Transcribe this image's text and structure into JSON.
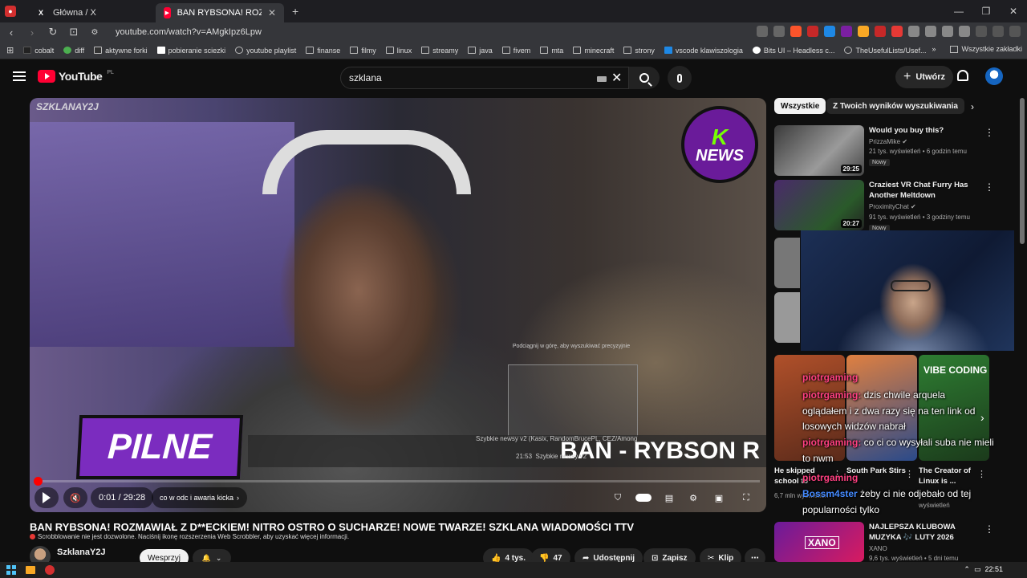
{
  "browser": {
    "tabs": [
      {
        "label": "Główna / X",
        "active": false
      },
      {
        "label": "BAN RYBSONA! ROZMAWIAŁ Z D",
        "active": true
      }
    ],
    "url": "youtube.com/watch?v=AMgkIpz6Lpw",
    "bookmarks": [
      "cobalt",
      "diff",
      "aktywne forki",
      "pobieranie sciezki",
      "youtube playlist",
      "finanse",
      "filmy",
      "linux",
      "streamy",
      "java",
      "fivem",
      "mta",
      "minecraft",
      "strony",
      "vscode klawiszologia",
      "Bits UI – Headless c...",
      "TheUsefulLists/Usef..."
    ],
    "bookmarks_right": "Wszystkie zakładki"
  },
  "youtube": {
    "logo_text": "YouTube",
    "logo_region": "PL",
    "search_value": "szklana",
    "create_label": "Utwórz"
  },
  "player": {
    "watermark": "SZKLANAY2J",
    "news_logo_k": "K",
    "news_logo_text": "NEWS",
    "pilne": "PILNE",
    "ticker": "BAN - RYBSON R",
    "pip_hint": "Podciągnij w górę, aby wyszukiwać precyzyjnie",
    "info_card": "Szybkie newsy v2 (Kasix, RandomBrucePL, CEZ/Among",
    "info_time": "21:53",
    "info_sub": "Szybkie newsy v2",
    "time": "0:01 / 29:28",
    "chapter": "co w odc i awaria kicka",
    "progress": 0.0006
  },
  "video": {
    "title": "BAN RYBSONA! ROZMAWIAŁ Z D**ECKIEM! NITRO OSTRO O SUCHARZE! NOWE TWARZE! SZKLANA WIADOMOŚCI TTV",
    "scrobbler_note": "Scrobblowanie nie jest dozwolone. Naciśnij ikonę rozszerzenia Web Scrobbler, aby uzyskać więcej informacji.",
    "channel": "SzklanaY2J",
    "support_label": "Wesprzyj",
    "likes": "4 tys.",
    "dislikes": "47",
    "share_label": "Udostępnij",
    "save_label": "Zapisz",
    "clip_label": "Klip"
  },
  "chips": [
    "Wszystkie",
    "Z Twoich wyników wyszukiwania"
  ],
  "recommendations": [
    {
      "title": "Would you buy this?",
      "channel": "PrizzaMike",
      "meta": "21 tys. wyświetleń • 6 godzin temu",
      "duration": "29:25",
      "badge": "Nowy",
      "color1": "#2a2a2a",
      "color2": "#8a8a8a"
    },
    {
      "title": "Craziest VR Chat Furry Has Another Meltdown",
      "channel": "ProximityChat",
      "meta": "91 tys. wyświetleń • 3 godziny temu",
      "duration": "20:27",
      "badge": "Nowy",
      "color1": "#4a2a6a",
      "color2": "#2e7d32"
    },
    {
      "title": "NAJLEPSZA KLUBOWA MUZYKA 🎶 LUTY 2026",
      "channel": "XANO",
      "meta": "9,6 tys. wyświetleń • 5 dni temu",
      "thumb_text": "XANO",
      "color1": "#6a1b9a",
      "color2": "#d81b60"
    }
  ],
  "shorts": [
    {
      "title": "He skipped school to",
      "views": "6,7 mln wyświetleń",
      "color": "#8d4a2a"
    },
    {
      "title": "South Park Stirs",
      "views": "",
      "color": "#c0602a"
    },
    {
      "title": "The Creator of Linux is ...",
      "views": "wyświetleń",
      "thumb_text": "VIBE CODING",
      "color": "#2e7d32"
    }
  ],
  "chat_overlay": [
    {
      "user": "piotrgaming",
      "text": ""
    },
    {
      "user": "piotrgaming:",
      "text": "dzis chwile arquela"
    },
    {
      "user": "",
      "text": "oglądałem i z dwa razy się na ten link od"
    },
    {
      "user": "",
      "text": "losowych widzów nabrał"
    },
    {
      "user": "piotrgaming:",
      "text": "co ci co wysyłali suba nie mieli"
    },
    {
      "user": "",
      "text": "to nwm"
    },
    {
      "user": "piotrgaming",
      "text": ""
    },
    {
      "user": "Bossm4ster",
      "text": "żeby ci nie odjebało od tej"
    },
    {
      "user": "",
      "text": "popularności tylko"
    }
  ],
  "taskbar": {
    "time": "22:51"
  }
}
